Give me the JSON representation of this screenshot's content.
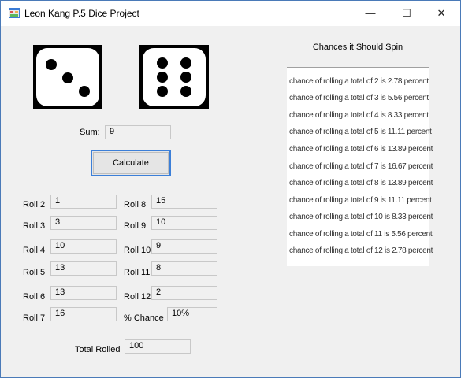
{
  "window": {
    "title": "Leon Kang P.5 Dice Project",
    "minimize_glyph": "—",
    "maximize_glyph": "☐",
    "close_glyph": "✕"
  },
  "dice": {
    "die1_value": 3,
    "die2_value": 6
  },
  "sum": {
    "label": "Sum:",
    "value": "9"
  },
  "calculate_button": "Calculate",
  "rolls_left": [
    {
      "label": "Roll 2",
      "value": "1"
    },
    {
      "label": "Roll 3",
      "value": "3"
    },
    {
      "label": "Roll 4",
      "value": "10"
    },
    {
      "label": "Roll 5",
      "value": "13"
    },
    {
      "label": "Roll 6",
      "value": "13"
    },
    {
      "label": "Roll 7",
      "value": "16"
    }
  ],
  "rolls_right": [
    {
      "label": "Roll 8",
      "value": "15"
    },
    {
      "label": "Roll 9",
      "value": "10"
    },
    {
      "label": "Roll 10",
      "value": "9"
    },
    {
      "label": "Roll 11",
      "value": "8"
    },
    {
      "label": "Roll 12",
      "value": "2"
    },
    {
      "label": "% Chance",
      "value": "10%"
    }
  ],
  "total": {
    "label": "Total Rolled",
    "value": "100"
  },
  "chances": {
    "heading": "Chances it Should Spin",
    "items": [
      "chance of rolling a total of 2 is 2.78 percent",
      "chance of rolling a total of 3 is 5.56 percent",
      "chance of rolling a total of 4 is 8.33 percent",
      "chance of rolling a total of 5 is 11.11 percent",
      "chance of rolling a total of 6 is 13.89 percent",
      "chance of rolling a total of 7 is 16.67 percent",
      "chance of rolling a total of 8 is 13.89 percent",
      "chance of rolling a total of 9 is 11.11 percent",
      "chance of rolling a total of 10 is 8.33 percent",
      "chance of rolling a total of 11 is 5.56 percent",
      "chance of rolling a total of 12 is 2.78 percent"
    ]
  }
}
